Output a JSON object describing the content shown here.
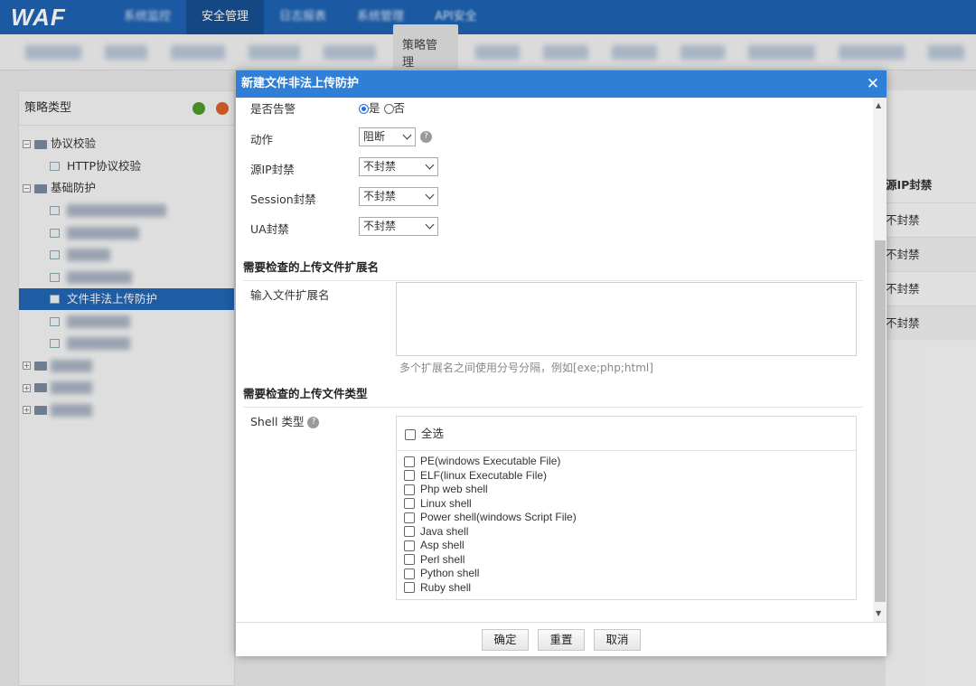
{
  "app": {
    "logo": "WAF"
  },
  "topnav": {
    "items": [
      {
        "label": "系统监控"
      },
      {
        "label": "安全管理"
      },
      {
        "label": "日志报表"
      },
      {
        "label": "系统管理"
      },
      {
        "label": "API安全"
      }
    ]
  },
  "subnav": {
    "active_label": "策略管理"
  },
  "leftpanel": {
    "title": "策略类型",
    "tree": {
      "group1": "协议校验",
      "group1_child": "HTTP协议校验",
      "group2": "基础防护",
      "selected_child": "文件非法上传防护"
    }
  },
  "background_table": {
    "header": "源IP封禁",
    "rows": [
      "不封禁",
      "不封禁",
      "不封禁",
      "不封禁"
    ]
  },
  "dialog": {
    "title": "新建文件非法上传防护",
    "close_glyph": "✕",
    "alarm": {
      "label": "是否告警",
      "yes": "是",
      "no": "否"
    },
    "action": {
      "label": "动作",
      "value": "阻断"
    },
    "src_ip_ban": {
      "label": "源IP封禁",
      "value": "不封禁"
    },
    "session_ban": {
      "label": "Session封禁",
      "value": "不封禁"
    },
    "ua_ban": {
      "label": "UA封禁",
      "value": "不封禁"
    },
    "ext_section": "需要检查的上传文件扩展名",
    "ext_label": "输入文件扩展名",
    "ext_hint": "多个扩展名之间使用分号分隔，例如[exe;php;html]",
    "type_section": "需要检查的上传文件类型",
    "shell_label": "Shell 类型",
    "select_all": "全选",
    "shell_types": [
      "PE(windows Executable File)",
      "ELF(linux Executable File)",
      "Php web shell",
      "Linux shell",
      "Power shell(windows Script File)",
      "Java shell",
      "Asp shell",
      "Perl shell",
      "Python shell",
      "Ruby shell"
    ],
    "buttons": {
      "ok": "确定",
      "reset": "重置",
      "cancel": "取消"
    }
  }
}
